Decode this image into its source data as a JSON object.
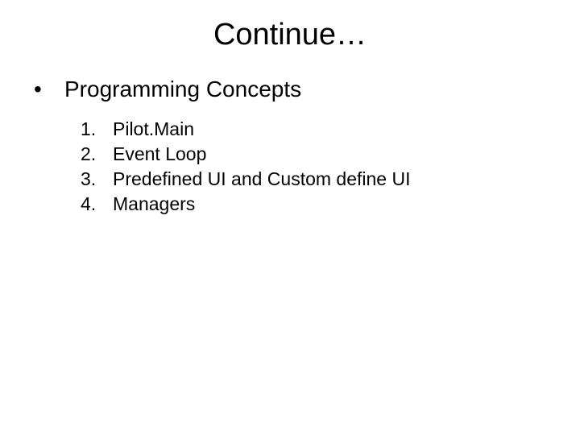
{
  "title": "Continue…",
  "section": {
    "bullet": "•",
    "heading": "Programming Concepts",
    "items": [
      {
        "num": "1.",
        "text": "Pilot.Main"
      },
      {
        "num": "2.",
        "text": "Event Loop"
      },
      {
        "num": "3.",
        "text": "Predefined UI and Custom define UI"
      },
      {
        "num": "4.",
        "text": "Managers"
      }
    ]
  }
}
